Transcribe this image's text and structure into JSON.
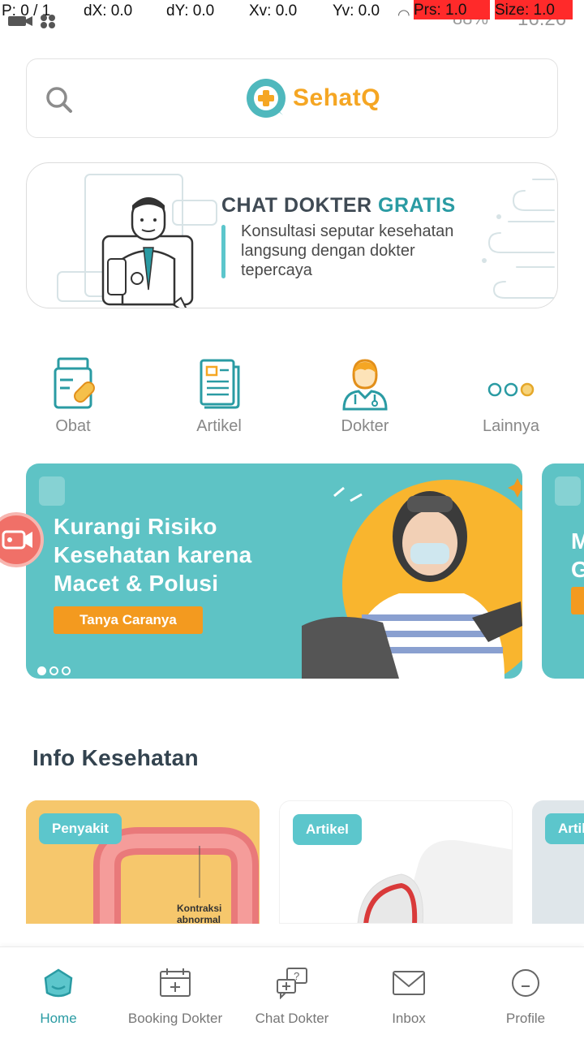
{
  "status_bar": {
    "pointer": "P: 0 / 1",
    "dx": "dX: 0.0",
    "dy": "dY: 0.0",
    "xv": "Xv: 0.0",
    "yv": "Yv: 0.0",
    "prs": "Prs: 1.0",
    "size": "Size: 1.0",
    "battery": "88%",
    "time": "16:26"
  },
  "header": {
    "brand_name": "SehatQ"
  },
  "chat_banner": {
    "title_part1": "CHAT DOKTER ",
    "title_part2": "GRATIS",
    "description": "Konsultasi seputar kesehatan langsung dengan dokter tepercaya"
  },
  "quick_menu": {
    "items": [
      {
        "label": "Obat",
        "icon": "medicine-bottle-icon"
      },
      {
        "label": "Artikel",
        "icon": "article-icon"
      },
      {
        "label": "Dokter",
        "icon": "doctor-icon"
      },
      {
        "label": "Lainnya",
        "icon": "more-dots-icon"
      }
    ]
  },
  "promo": {
    "title": "Kurangi Risiko Kesehatan karena Macet & Polusi",
    "button_label": "Tanya Caranya",
    "peek_text": "M G",
    "slide_count": 3,
    "active_slide": 1
  },
  "info_section": {
    "title": "Info Kesehatan",
    "cards": [
      {
        "tag": "Penyakit",
        "caption": "Kontraksi abnormal"
      },
      {
        "tag": "Artikel"
      },
      {
        "tag": "Artikel"
      }
    ]
  },
  "bottom_nav": {
    "items": [
      {
        "label": "Home",
        "icon": "home-icon",
        "active": true
      },
      {
        "label": "Booking Dokter",
        "icon": "calendar-add-icon",
        "active": false
      },
      {
        "label": "Chat Dokter",
        "icon": "chat-question-icon",
        "active": false
      },
      {
        "label": "Inbox",
        "icon": "mail-icon",
        "active": false
      },
      {
        "label": "Profile",
        "icon": "profile-icon",
        "active": false
      }
    ]
  },
  "colors": {
    "brand_teal": "#2a9ba3",
    "brand_orange": "#f5a623",
    "promo_bg": "#5ec3c5",
    "accent_button": "#f39a1f"
  }
}
